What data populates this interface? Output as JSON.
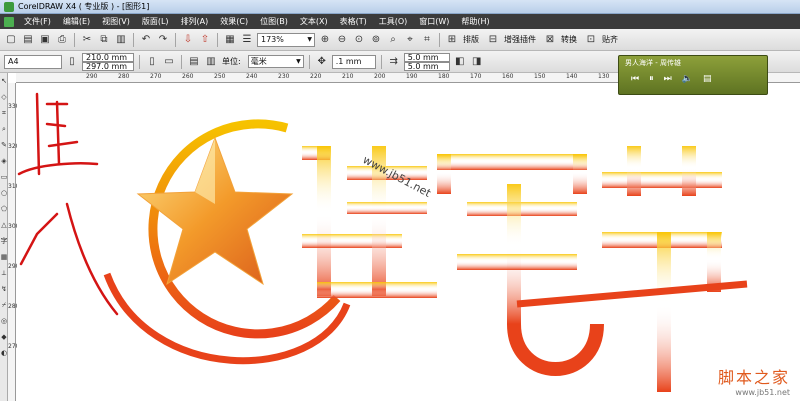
{
  "window": {
    "title": "CorelDRAW X4 ( 专业版 ) - [图形1]"
  },
  "menu": [
    "文件(F)",
    "编辑(E)",
    "视图(V)",
    "版面(L)",
    "排列(A)",
    "效果(C)",
    "位图(B)",
    "文本(X)",
    "表格(T)",
    "工具(O)",
    "窗口(W)",
    "帮助(H)"
  ],
  "toolbar": {
    "zoom": "173%",
    "labels": {
      "layout": "排版",
      "plugins": "增强插件",
      "convert": "转换",
      "paste": "贴齐"
    }
  },
  "property_bar": {
    "paper": "A4",
    "width": "210.0 mm",
    "height": "297.0 mm",
    "units_label": "单位:",
    "units_value": "毫米",
    "nudge": ".1 mm",
    "dup_x": "5.0 mm",
    "dup_y": "5.0 mm"
  },
  "ruler_top": [
    "290",
    "280",
    "270",
    "260",
    "250",
    "240",
    "230",
    "220",
    "210",
    "200",
    "190",
    "180",
    "170",
    "160",
    "150",
    "140",
    "130"
  ],
  "ruler_left": [
    "330",
    "320",
    "310",
    "300",
    "290",
    "280",
    "270"
  ],
  "player": {
    "title": "男人海洋 - 周传雄"
  },
  "artwork": {
    "text": "建军节",
    "handwriting": "置入",
    "watermark_diagonal": "www.jb51.net",
    "gradient_top": "#f6c200",
    "gradient_bottom": "#e8421a"
  },
  "watermark": {
    "cn": "脚本之家",
    "url": "www.jb51.net"
  }
}
